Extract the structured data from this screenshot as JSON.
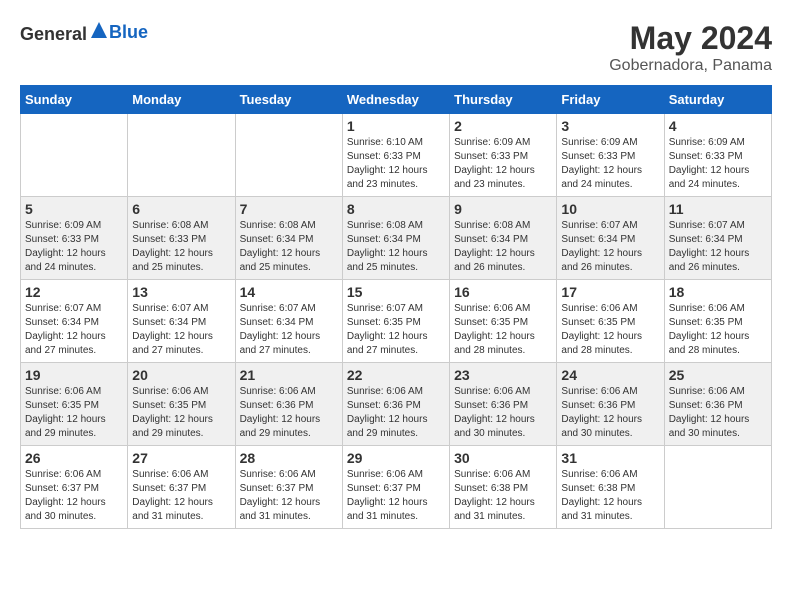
{
  "header": {
    "logo_general": "General",
    "logo_blue": "Blue",
    "month_year": "May 2024",
    "location": "Gobernadora, Panama"
  },
  "weekdays": [
    "Sunday",
    "Monday",
    "Tuesday",
    "Wednesday",
    "Thursday",
    "Friday",
    "Saturday"
  ],
  "weeks": [
    [
      {
        "day": "",
        "sunrise": "",
        "sunset": "",
        "daylight": ""
      },
      {
        "day": "",
        "sunrise": "",
        "sunset": "",
        "daylight": ""
      },
      {
        "day": "",
        "sunrise": "",
        "sunset": "",
        "daylight": ""
      },
      {
        "day": "1",
        "sunrise": "Sunrise: 6:10 AM",
        "sunset": "Sunset: 6:33 PM",
        "daylight": "Daylight: 12 hours and 23 minutes."
      },
      {
        "day": "2",
        "sunrise": "Sunrise: 6:09 AM",
        "sunset": "Sunset: 6:33 PM",
        "daylight": "Daylight: 12 hours and 23 minutes."
      },
      {
        "day": "3",
        "sunrise": "Sunrise: 6:09 AM",
        "sunset": "Sunset: 6:33 PM",
        "daylight": "Daylight: 12 hours and 24 minutes."
      },
      {
        "day": "4",
        "sunrise": "Sunrise: 6:09 AM",
        "sunset": "Sunset: 6:33 PM",
        "daylight": "Daylight: 12 hours and 24 minutes."
      }
    ],
    [
      {
        "day": "5",
        "sunrise": "Sunrise: 6:09 AM",
        "sunset": "Sunset: 6:33 PM",
        "daylight": "Daylight: 12 hours and 24 minutes."
      },
      {
        "day": "6",
        "sunrise": "Sunrise: 6:08 AM",
        "sunset": "Sunset: 6:33 PM",
        "daylight": "Daylight: 12 hours and 25 minutes."
      },
      {
        "day": "7",
        "sunrise": "Sunrise: 6:08 AM",
        "sunset": "Sunset: 6:34 PM",
        "daylight": "Daylight: 12 hours and 25 minutes."
      },
      {
        "day": "8",
        "sunrise": "Sunrise: 6:08 AM",
        "sunset": "Sunset: 6:34 PM",
        "daylight": "Daylight: 12 hours and 25 minutes."
      },
      {
        "day": "9",
        "sunrise": "Sunrise: 6:08 AM",
        "sunset": "Sunset: 6:34 PM",
        "daylight": "Daylight: 12 hours and 26 minutes."
      },
      {
        "day": "10",
        "sunrise": "Sunrise: 6:07 AM",
        "sunset": "Sunset: 6:34 PM",
        "daylight": "Daylight: 12 hours and 26 minutes."
      },
      {
        "day": "11",
        "sunrise": "Sunrise: 6:07 AM",
        "sunset": "Sunset: 6:34 PM",
        "daylight": "Daylight: 12 hours and 26 minutes."
      }
    ],
    [
      {
        "day": "12",
        "sunrise": "Sunrise: 6:07 AM",
        "sunset": "Sunset: 6:34 PM",
        "daylight": "Daylight: 12 hours and 27 minutes."
      },
      {
        "day": "13",
        "sunrise": "Sunrise: 6:07 AM",
        "sunset": "Sunset: 6:34 PM",
        "daylight": "Daylight: 12 hours and 27 minutes."
      },
      {
        "day": "14",
        "sunrise": "Sunrise: 6:07 AM",
        "sunset": "Sunset: 6:34 PM",
        "daylight": "Daylight: 12 hours and 27 minutes."
      },
      {
        "day": "15",
        "sunrise": "Sunrise: 6:07 AM",
        "sunset": "Sunset: 6:35 PM",
        "daylight": "Daylight: 12 hours and 27 minutes."
      },
      {
        "day": "16",
        "sunrise": "Sunrise: 6:06 AM",
        "sunset": "Sunset: 6:35 PM",
        "daylight": "Daylight: 12 hours and 28 minutes."
      },
      {
        "day": "17",
        "sunrise": "Sunrise: 6:06 AM",
        "sunset": "Sunset: 6:35 PM",
        "daylight": "Daylight: 12 hours and 28 minutes."
      },
      {
        "day": "18",
        "sunrise": "Sunrise: 6:06 AM",
        "sunset": "Sunset: 6:35 PM",
        "daylight": "Daylight: 12 hours and 28 minutes."
      }
    ],
    [
      {
        "day": "19",
        "sunrise": "Sunrise: 6:06 AM",
        "sunset": "Sunset: 6:35 PM",
        "daylight": "Daylight: 12 hours and 29 minutes."
      },
      {
        "day": "20",
        "sunrise": "Sunrise: 6:06 AM",
        "sunset": "Sunset: 6:35 PM",
        "daylight": "Daylight: 12 hours and 29 minutes."
      },
      {
        "day": "21",
        "sunrise": "Sunrise: 6:06 AM",
        "sunset": "Sunset: 6:36 PM",
        "daylight": "Daylight: 12 hours and 29 minutes."
      },
      {
        "day": "22",
        "sunrise": "Sunrise: 6:06 AM",
        "sunset": "Sunset: 6:36 PM",
        "daylight": "Daylight: 12 hours and 29 minutes."
      },
      {
        "day": "23",
        "sunrise": "Sunrise: 6:06 AM",
        "sunset": "Sunset: 6:36 PM",
        "daylight": "Daylight: 12 hours and 30 minutes."
      },
      {
        "day": "24",
        "sunrise": "Sunrise: 6:06 AM",
        "sunset": "Sunset: 6:36 PM",
        "daylight": "Daylight: 12 hours and 30 minutes."
      },
      {
        "day": "25",
        "sunrise": "Sunrise: 6:06 AM",
        "sunset": "Sunset: 6:36 PM",
        "daylight": "Daylight: 12 hours and 30 minutes."
      }
    ],
    [
      {
        "day": "26",
        "sunrise": "Sunrise: 6:06 AM",
        "sunset": "Sunset: 6:37 PM",
        "daylight": "Daylight: 12 hours and 30 minutes."
      },
      {
        "day": "27",
        "sunrise": "Sunrise: 6:06 AM",
        "sunset": "Sunset: 6:37 PM",
        "daylight": "Daylight: 12 hours and 31 minutes."
      },
      {
        "day": "28",
        "sunrise": "Sunrise: 6:06 AM",
        "sunset": "Sunset: 6:37 PM",
        "daylight": "Daylight: 12 hours and 31 minutes."
      },
      {
        "day": "29",
        "sunrise": "Sunrise: 6:06 AM",
        "sunset": "Sunset: 6:37 PM",
        "daylight": "Daylight: 12 hours and 31 minutes."
      },
      {
        "day": "30",
        "sunrise": "Sunrise: 6:06 AM",
        "sunset": "Sunset: 6:38 PM",
        "daylight": "Daylight: 12 hours and 31 minutes."
      },
      {
        "day": "31",
        "sunrise": "Sunrise: 6:06 AM",
        "sunset": "Sunset: 6:38 PM",
        "daylight": "Daylight: 12 hours and 31 minutes."
      },
      {
        "day": "",
        "sunrise": "",
        "sunset": "",
        "daylight": ""
      }
    ]
  ]
}
